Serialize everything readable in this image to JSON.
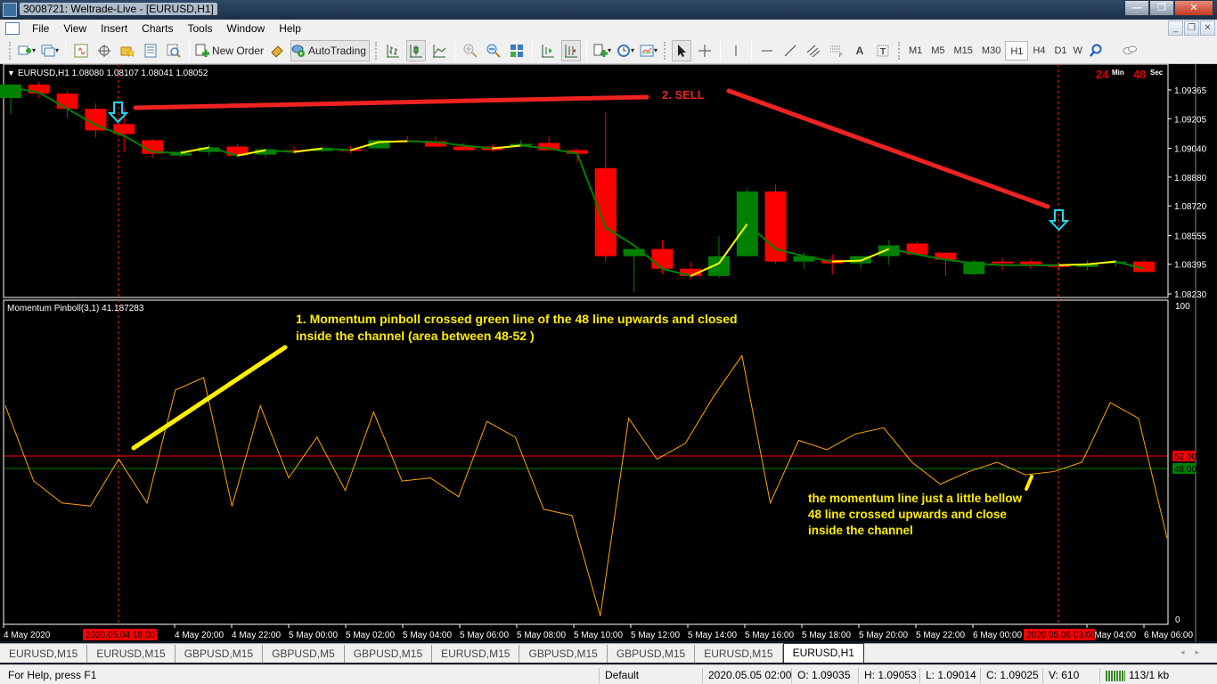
{
  "window": {
    "title": "3008721: Weltrade-Live - [EURUSD,H1]",
    "controls": [
      "minimize",
      "restore",
      "close"
    ]
  },
  "menu": [
    "File",
    "View",
    "Insert",
    "Charts",
    "Tools",
    "Window",
    "Help"
  ],
  "toolbar": {
    "new_order_label": "New Order",
    "autotrading_label": "AutoTrading",
    "timeframes": [
      "M1",
      "M5",
      "M15",
      "M30",
      "H1",
      "H4",
      "D1",
      "W"
    ],
    "active_timeframe": "H1",
    "icons": [
      "new-chart-icon",
      "profiles-icon",
      "market-watch-icon",
      "crosshair-data-icon",
      "navigator-icon",
      "terminal-icon",
      "strategy-tester-icon",
      "new-order-icon",
      "metaeditor-icon",
      "autotrading-icon",
      "bar-chart-icon",
      "candlestick-icon",
      "line-chart-icon",
      "zoom-in-icon",
      "zoom-out-icon",
      "tile-windows-icon",
      "autoscroll-icon",
      "chart-shift-icon",
      "indicators-icon",
      "periods-icon",
      "templates-icon",
      "cursor-icon",
      "crosshair-icon",
      "vertical-line-icon",
      "horizontal-line-icon",
      "trendline-icon",
      "equidistant-channel-icon",
      "fibonacci-icon",
      "text-icon",
      "text-label-icon",
      "search-icon",
      "chat-icon"
    ]
  },
  "chart": {
    "header": "EURUSD,H1  1.08080 1.08107 1.08041 1.08052",
    "timer": {
      "minutes": "24",
      "min_label": "Min",
      "seconds": "48",
      "sec_label": "Sec"
    },
    "annotation_sell": "2.  SELL",
    "annotation_1": [
      "1. Momentum pinboll crossed green line of the 48 line upwards and closed",
      "inside the channel (area between 48-52 )"
    ],
    "annotation_2": [
      "the momentum line just a little bellow",
      "48 line crossed upwards and close",
      "inside the channel"
    ],
    "indicator_label": "Momentum Pinboll(3,1) 41.187283",
    "level_52": "52.000000",
    "level_48": "48.000000",
    "indicator_axis": [
      "100",
      "0"
    ],
    "vline_labels": [
      "2020.05.04 18:00",
      "2020.05.06 03:00"
    ]
  },
  "chart_data": {
    "type": "candlestick",
    "symbol": "EURUSD",
    "timeframe": "H1",
    "price_axis_ticks": [
      "1.09365",
      "1.09205",
      "1.09040",
      "1.08880",
      "1.08720",
      "1.08555",
      "1.08395",
      "1.08230"
    ],
    "ylim": [
      1.0821,
      1.0942
    ],
    "time_axis_labels": [
      "4 May 2020",
      "4 May 18:00",
      "4 May 20:00",
      "4 May 22:00",
      "5 May 00:00",
      "5 May 02:00",
      "5 May 04:00",
      "5 May 06:00",
      "5 May 08:00",
      "5 May 10:00",
      "5 May 12:00",
      "5 May 14:00",
      "5 May 16:00",
      "5 May 18:00",
      "5 May 20:00",
      "5 May 22:00",
      "6 May 00:00",
      "6 May 03:00",
      "6 May 04:00",
      "6 May 06:00"
    ],
    "candles": [
      {
        "o": 1.0932,
        "h": 1.094,
        "l": 1.0923,
        "c": 1.09395
      },
      {
        "o": 1.09395,
        "h": 1.0941,
        "l": 1.0932,
        "c": 1.09345
      },
      {
        "o": 1.09345,
        "h": 1.0936,
        "l": 1.0921,
        "c": 1.0926
      },
      {
        "o": 1.0926,
        "h": 1.0929,
        "l": 1.091,
        "c": 1.0914
      },
      {
        "o": 1.09175,
        "h": 1.0927,
        "l": 1.0902,
        "c": 1.0912
      },
      {
        "o": 1.09085,
        "h": 1.09095,
        "l": 1.08985,
        "c": 1.0901
      },
      {
        "o": 1.09,
        "h": 1.0903,
        "l": 1.0899,
        "c": 1.09015
      },
      {
        "o": 1.0902,
        "h": 1.0906,
        "l": 1.09,
        "c": 1.09045
      },
      {
        "o": 1.0905,
        "h": 1.09065,
        "l": 1.0899,
        "c": 1.09
      },
      {
        "o": 1.09005,
        "h": 1.0904,
        "l": 1.0899,
        "c": 1.09035
      },
      {
        "o": 1.0903,
        "h": 1.0905,
        "l": 1.0901,
        "c": 1.0902
      },
      {
        "o": 1.09025,
        "h": 1.09045,
        "l": 1.0902,
        "c": 1.0904
      },
      {
        "o": 1.09035,
        "h": 1.09053,
        "l": 1.09014,
        "c": 1.09025
      },
      {
        "o": 1.0904,
        "h": 1.0909,
        "l": 1.09035,
        "c": 1.09085
      },
      {
        "o": 1.09085,
        "h": 1.0911,
        "l": 1.0907,
        "c": 1.0908
      },
      {
        "o": 1.0908,
        "h": 1.09105,
        "l": 1.0906,
        "c": 1.0905
      },
      {
        "o": 1.0905,
        "h": 1.0907,
        "l": 1.0903,
        "c": 1.0903
      },
      {
        "o": 1.0905,
        "h": 1.0906,
        "l": 1.0902,
        "c": 1.0903
      },
      {
        "o": 1.0906,
        "h": 1.09085,
        "l": 1.0905,
        "c": 1.09065
      },
      {
        "o": 1.0907,
        "h": 1.0911,
        "l": 1.0903,
        "c": 1.0903
      },
      {
        "o": 1.0903,
        "h": 1.0904,
        "l": 1.0896,
        "c": 1.0901
      },
      {
        "o": 1.0893,
        "h": 1.0924,
        "l": 1.0841,
        "c": 1.0844
      },
      {
        "o": 1.0844,
        "h": 1.0848,
        "l": 1.0824,
        "c": 1.0848
      },
      {
        "o": 1.0848,
        "h": 1.0853,
        "l": 1.0834,
        "c": 1.0837
      },
      {
        "o": 1.0837,
        "h": 1.0841,
        "l": 1.0831,
        "c": 1.0833
      },
      {
        "o": 1.0833,
        "h": 1.0855,
        "l": 1.0832,
        "c": 1.0844
      },
      {
        "o": 1.0844,
        "h": 1.0882,
        "l": 1.0844,
        "c": 1.088
      },
      {
        "o": 1.088,
        "h": 1.0884,
        "l": 1.084,
        "c": 1.0841
      },
      {
        "o": 1.0841,
        "h": 1.0846,
        "l": 1.0837,
        "c": 1.0844
      },
      {
        "o": 1.0842,
        "h": 1.0845,
        "l": 1.0834,
        "c": 1.084
      },
      {
        "o": 1.084,
        "h": 1.0844,
        "l": 1.0837,
        "c": 1.0844
      },
      {
        "o": 1.0844,
        "h": 1.0853,
        "l": 1.0839,
        "c": 1.085
      },
      {
        "o": 1.0851,
        "h": 1.0852,
        "l": 1.0845,
        "c": 1.0845
      },
      {
        "o": 1.0846,
        "h": 1.0846,
        "l": 1.0833,
        "c": 1.0842
      },
      {
        "o": 1.0834,
        "h": 1.0842,
        "l": 1.0833,
        "c": 1.0841
      },
      {
        "o": 1.0841,
        "h": 1.0843,
        "l": 1.0836,
        "c": 1.084
      },
      {
        "o": 1.0841,
        "h": 1.0842,
        "l": 1.0837,
        "c": 1.08395
      },
      {
        "o": 1.08395,
        "h": 1.084,
        "l": 1.0836,
        "c": 1.0838
      },
      {
        "o": 1.0838,
        "h": 1.0842,
        "l": 1.0836,
        "c": 1.08395
      },
      {
        "o": 1.084,
        "h": 1.0842,
        "l": 1.0838,
        "c": 1.0841
      },
      {
        "o": 1.0841,
        "h": 1.0842,
        "l": 1.0835,
        "c": 1.08352
      }
    ],
    "ma_line": [
      1.0938,
      1.0935,
      1.0926,
      1.0917,
      1.0911,
      1.0902,
      1.09015,
      1.09045,
      1.09,
      1.0903,
      1.0902,
      1.0904,
      1.0903,
      1.09075,
      1.0908,
      1.09075,
      1.09055,
      1.0904,
      1.09055,
      1.0904,
      1.0901,
      1.086,
      1.085,
      1.0837,
      1.0833,
      1.084,
      1.0862,
      1.0848,
      1.0844,
      1.0841,
      1.08415,
      1.0848,
      1.0845,
      1.0842,
      1.084,
      1.0839,
      1.0839,
      1.0839,
      1.08395,
      1.0841,
      1.0837
    ],
    "indicator": {
      "name": "Momentum Pinboll(3,1)",
      "last_value": 41.187283,
      "ylim": [
        0,
        100
      ],
      "levels": [
        52,
        48
      ],
      "values": [
        68,
        44,
        37,
        36,
        51,
        37,
        73,
        77,
        36,
        68,
        45,
        58,
        41,
        66,
        44,
        45,
        39,
        63,
        58,
        35,
        33,
        1,
        64,
        51,
        56,
        71,
        84,
        37,
        57,
        54,
        59,
        61,
        50,
        43,
        47,
        50,
        46,
        47,
        50,
        69,
        64,
        26
      ]
    }
  },
  "symbol_tabs": [
    "EURUSD,M15",
    "EURUSD,M15",
    "GBPUSD,M15",
    "GBPUSD,M5",
    "GBPUSD,M15",
    "EURUSD,M15",
    "GBPUSD,M15",
    "GBPUSD,M15",
    "EURUSD,M15",
    "EURUSD,H1"
  ],
  "active_tab": "EURUSD,H1",
  "status": {
    "help": "For Help, press F1",
    "profile": "Default",
    "datetime": "2020.05.05 02:00",
    "open": "O: 1.09035",
    "high": "H: 1.09053",
    "low": "L: 1.09014",
    "close": "C: 1.09025",
    "volume": "V: 610",
    "traffic": "113/1 kb"
  },
  "colors": {
    "bull": "#008000",
    "bear": "#ff0000",
    "ma_up": "#ffff00",
    "ma_down": "#008000",
    "indicator": "#ffa500",
    "level52": "#ff0000",
    "level48": "#008000",
    "annotation": "#ffff00",
    "sell": "#ff2020",
    "arrow": "#00e5ff"
  }
}
